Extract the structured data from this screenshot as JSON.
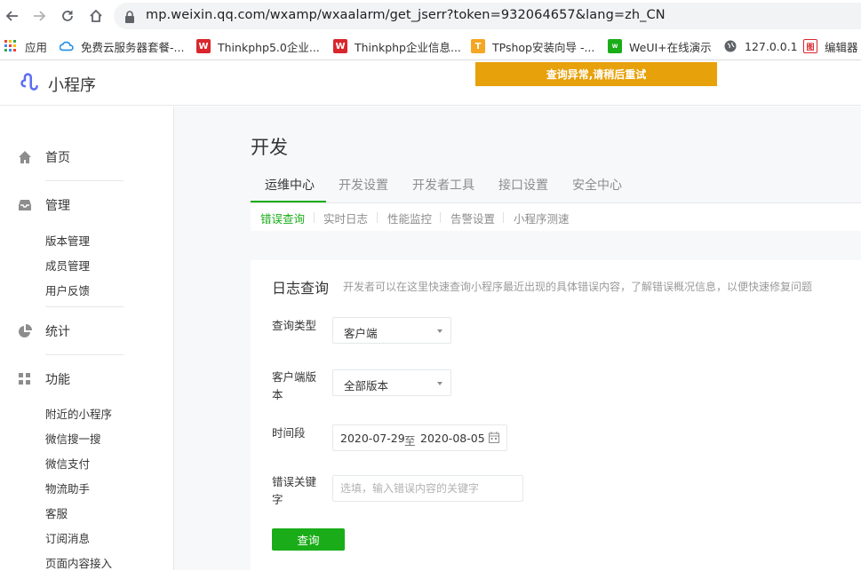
{
  "browser": {
    "url": "mp.weixin.qq.com/wxamp/wxaalarm/get_jserr?token=932064657&lang=zh_CN",
    "bookmarks": [
      {
        "label": "应用",
        "icon": "apps-grid-icon"
      },
      {
        "label": "免费云服务器套餐-...",
        "icon": "cloud-icon"
      },
      {
        "label": "Thinkphp5.0企业...",
        "icon": "thinkphp-icon"
      },
      {
        "label": "Thinkphp企业信息...",
        "icon": "thinkphp-icon"
      },
      {
        "label": "TPshop安装向导 -...",
        "icon": "tpshop-icon"
      },
      {
        "label": "WeUI+在线演示",
        "icon": "weui-icon"
      },
      {
        "label": "127.0.0.1",
        "icon": "globe-icon"
      },
      {
        "label": "编辑器",
        "icon": "editor-icon"
      }
    ]
  },
  "header": {
    "logo_text": "小程序",
    "alert": "查询异常,请稍后重试"
  },
  "sidebar": {
    "sections": [
      {
        "label": "首页",
        "icon": "home-icon",
        "items": []
      },
      {
        "label": "管理",
        "icon": "inbox-icon",
        "items": [
          "版本管理",
          "成员管理",
          "用户反馈"
        ]
      },
      {
        "label": "统计",
        "icon": "pie-chart-icon",
        "items": []
      },
      {
        "label": "功能",
        "icon": "grid-icon",
        "items": [
          "附近的小程序",
          "微信搜一搜",
          "微信支付",
          "物流助手",
          "客服",
          "订阅消息",
          "页面内容接入"
        ]
      }
    ]
  },
  "main": {
    "title": "开发",
    "tabs": [
      "运维中心",
      "开发设置",
      "开发者工具",
      "接口设置",
      "安全中心"
    ],
    "active_tab": "运维中心",
    "subtabs": [
      "错误查询",
      "实时日志",
      "性能监控",
      "告警设置",
      "小程序测速"
    ],
    "active_subtab": "错误查询",
    "panel": {
      "title": "日志查询",
      "description": "开发者可以在这里快速查询小程序最近出现的具体错误内容，了解错误概况信息，以便快速修复问题",
      "query_type_label": "查询类型",
      "query_type_value": "客户端",
      "client_version_label": "客户端版本",
      "client_version_value": "全部版本",
      "time_range_label": "时间段",
      "date_from": "2020-07-29",
      "date_sep": "至",
      "date_to": "2020-08-05",
      "keyword_label": "错误关键字",
      "keyword_placeholder": "选填，输入错误内容的关键字",
      "query_button": "查询"
    }
  },
  "colors": {
    "accent_green": "#1aad19",
    "alert_orange": "#e7a10b"
  }
}
